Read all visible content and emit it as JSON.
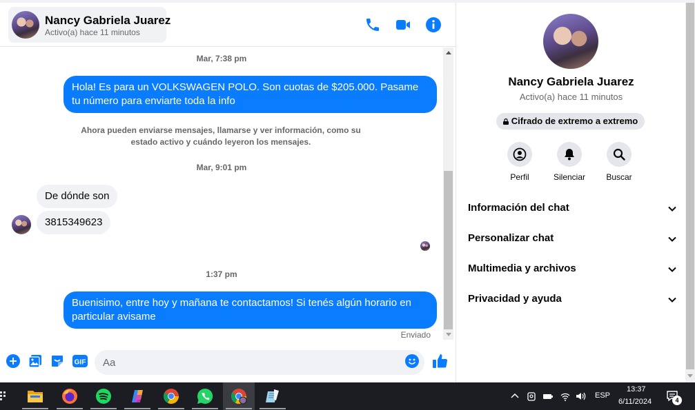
{
  "header": {
    "contact_name": "Nancy Gabriela Juarez",
    "status": "Activo(a) hace 11 minutos"
  },
  "messages": {
    "time1": "Mar, 7:38 pm",
    "out1": "Hola! Es para un VOLKSWAGEN POLO. Son cuotas de $205.000. Pasame tu número para enviarte toda la info",
    "system_note": "Ahora pueden enviarse mensajes, llamarse y ver información, como su estado activo y cuándo leyeron los mensajes.",
    "time2": "Mar, 9:01 pm",
    "in1": "De dónde son",
    "in2": "3815349623",
    "time3": "1:37 pm",
    "out2": "Buenisimo, entre hoy y mañana te contactamos! Si tenés algún horario en particular avisame",
    "sent_status": "Enviado"
  },
  "composer": {
    "placeholder": "Aa",
    "gif_label": "GIF"
  },
  "panel": {
    "name": "Nancy Gabriela Juarez",
    "status": "Activo(a) hace 11 minutos",
    "e2e_label": "Cifrado de extremo a extremo",
    "actions": [
      {
        "label": "Perfil",
        "icon": "profile-icon"
      },
      {
        "label": "Silenciar",
        "icon": "bell-icon"
      },
      {
        "label": "Buscar",
        "icon": "search-icon"
      }
    ],
    "sections": [
      {
        "label": "Información del chat"
      },
      {
        "label": "Personalizar chat"
      },
      {
        "label": "Multimedia y archivos"
      },
      {
        "label": "Privacidad y ayuda"
      }
    ]
  },
  "taskbar": {
    "language": "ESP",
    "time": "13:37",
    "date": "6/11/2024",
    "notification_count": "4"
  },
  "colors": {
    "accent": "#0a7cff",
    "bubble_in": "#f0f2f5",
    "taskbar": "#1b1d22"
  }
}
